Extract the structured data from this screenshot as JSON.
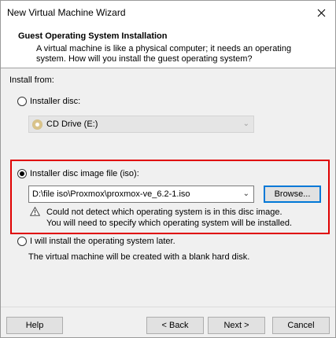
{
  "window": {
    "title": "New Virtual Machine Wizard"
  },
  "header": {
    "title": "Guest Operating System Installation",
    "description_line1": "A virtual machine is like a physical computer; it needs an operating",
    "description_line2": "system. How will you install the guest operating system?"
  },
  "install_from_label": "Install from:",
  "options": {
    "installer_disc": {
      "label": "Installer disc:",
      "selected": false,
      "drive": "CD Drive (E:)"
    },
    "iso": {
      "label": "Installer disc image file (iso):",
      "selected": true,
      "path": "D:\\file iso\\Proxmox\\proxmox-ve_6.2-1.iso",
      "browse_label": "Browse...",
      "warning_line1": "Could not detect which operating system is in this disc image.",
      "warning_line2": "You will need to specify which operating system will be installed."
    },
    "later": {
      "label": "I will install the operating system later.",
      "selected": false,
      "description": "The virtual machine will be created with a blank hard disk."
    }
  },
  "buttons": {
    "help": "Help",
    "back": "< Back",
    "next": "Next >",
    "cancel": "Cancel"
  },
  "highlight_color": "#e00000"
}
